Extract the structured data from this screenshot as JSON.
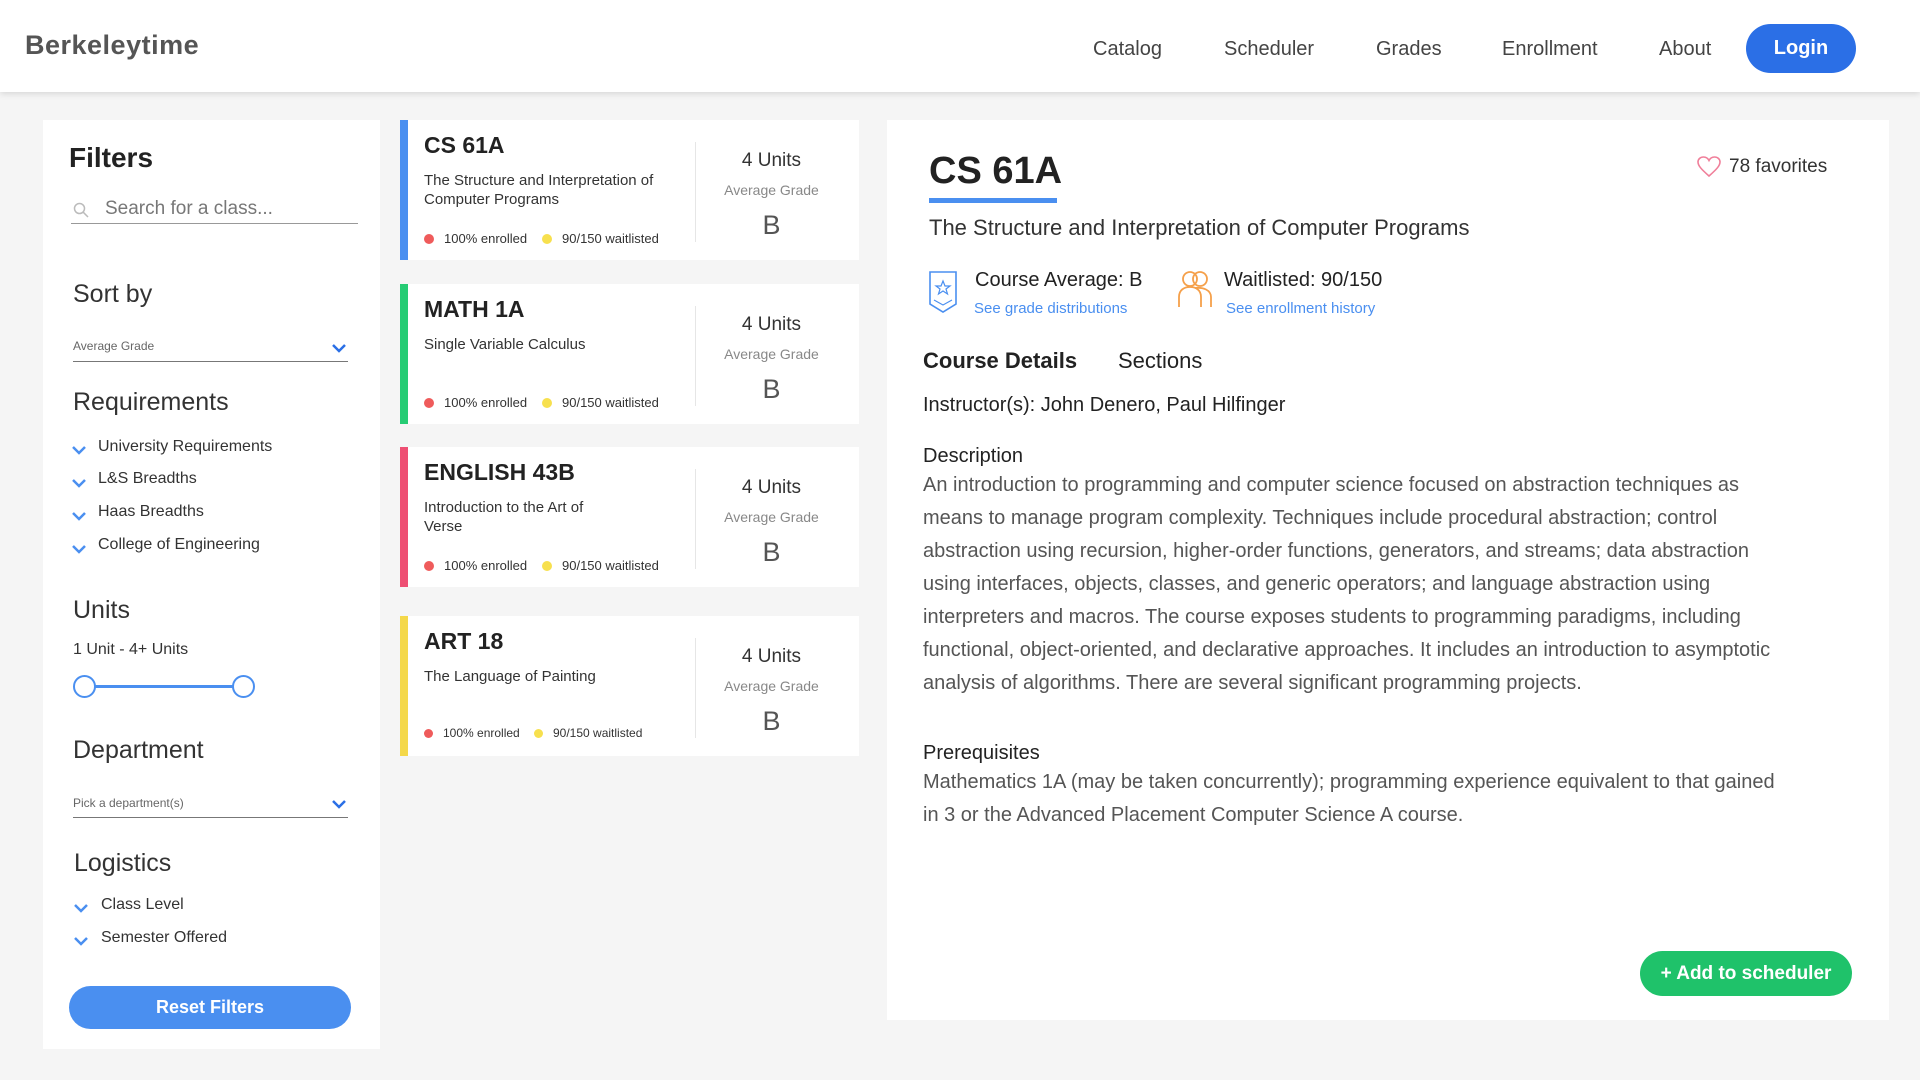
{
  "header": {
    "brand": "Berkeleytime",
    "nav": [
      "Catalog",
      "Scheduler",
      "Grades",
      "Enrollment",
      "About"
    ],
    "login_label": "Login"
  },
  "filters": {
    "title": "Filters",
    "search_placeholder": "Search for a class...",
    "sort_by": {
      "label": "Sort by",
      "value": "Average Grade"
    },
    "requirements": {
      "label": "Requirements",
      "items": [
        "University Requirements",
        "L&S Breadths",
        "Haas Breadths",
        "College of Engineering"
      ]
    },
    "units": {
      "label": "Units",
      "range_text": "1 Unit - 4+ Units"
    },
    "department": {
      "label": "Department",
      "placeholder": "Pick a department(s)"
    },
    "logistics": {
      "label": "Logistics",
      "items": [
        "Class Level",
        "Semester Offered"
      ]
    },
    "reset_label": "Reset Filters"
  },
  "courses": [
    {
      "code": "CS 61A",
      "title": "The Structure and Interpretation of Computer Programs",
      "enrolled": "100% enrolled",
      "waitlisted": "90/150 waitlisted",
      "units": "4 Units",
      "avg_label": "Average Grade",
      "grade": "B",
      "color": "#4a8ff0"
    },
    {
      "code": "MATH 1A",
      "title": "Single Variable Calculus",
      "enrolled": "100% enrolled",
      "waitlisted": "90/150 waitlisted",
      "units": "4 Units",
      "avg_label": "Average Grade",
      "grade": "B",
      "color": "#26cc74"
    },
    {
      "code": "ENGLISH 43B",
      "title": "Introduction to the Art of Verse",
      "enrolled": "100% enrolled",
      "waitlisted": "90/150 waitlisted",
      "units": "4 Units",
      "avg_label": "Average Grade",
      "grade": "B",
      "color": "#ee4f73"
    },
    {
      "code": "ART 18",
      "title": "The Language of Painting",
      "enrolled": "100% enrolled",
      "waitlisted": "90/150 waitlisted",
      "units": "4 Units",
      "avg_label": "Average Grade",
      "grade": "B",
      "color": "#f4d84a"
    }
  ],
  "detail": {
    "code": "CS 61A",
    "favorites": "78 favorites",
    "title": "The Structure and Interpretation of Computer Programs",
    "course_average": "Course Average: B",
    "grade_link": "See grade distributions",
    "waitlisted": "Waitlisted: 90/150",
    "enrollment_link": "See enrollment history",
    "tabs": [
      "Course Details",
      "Sections"
    ],
    "instructors": "Instructor(s): John Denero, Paul Hilfinger",
    "description_label": "Description",
    "description": "An introduction to programming and computer science focused on abstraction techniques as means to manage program complexity. Techniques include procedural abstraction; control abstraction using recursion, higher-order functions, generators, and streams; data abstraction using interfaces, objects, classes, and generic operators; and language abstraction using interpreters and macros. The course exposes students to programming paradigms, including functional, object-oriented, and declarative approaches. It includes an introduction to asymptotic analysis of algorithms. There are several significant programming projects.",
    "prereq_label": "Prerequisites",
    "prerequisites": "Mathematics 1A (may be taken concurrently); programming experience equivalent to that gained in 3 or the Advanced Placement Computer Science A course.",
    "add_label": "+ Add to scheduler"
  },
  "colors": {
    "primary": "#2b6fe6",
    "accent_blue": "#4a8ff0",
    "enrolled_dot": "#ef5b5b",
    "waitlist_dot": "#f7e04e",
    "add_green": "#1fc26a",
    "heart": "#f07f9a",
    "waitlist_icon": "#f5a04a"
  }
}
